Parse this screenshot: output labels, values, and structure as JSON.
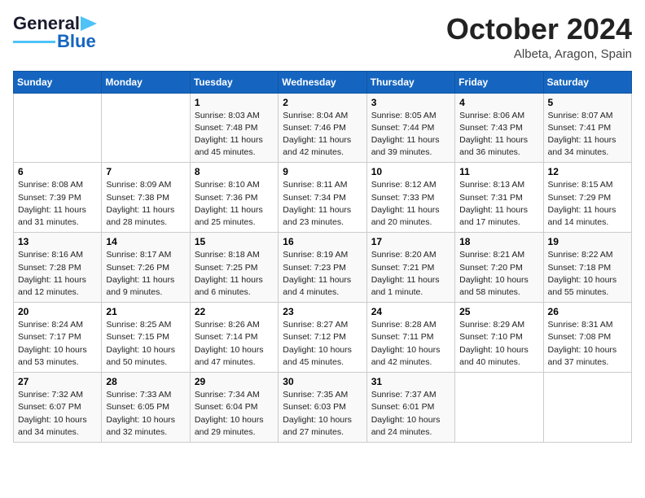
{
  "header": {
    "logo_general": "General",
    "logo_blue": "Blue",
    "month": "October 2024",
    "location": "Albeta, Aragon, Spain"
  },
  "days_of_week": [
    "Sunday",
    "Monday",
    "Tuesday",
    "Wednesday",
    "Thursday",
    "Friday",
    "Saturday"
  ],
  "weeks": [
    [
      {
        "day": "",
        "sunrise": "",
        "sunset": "",
        "daylight": ""
      },
      {
        "day": "",
        "sunrise": "",
        "sunset": "",
        "daylight": ""
      },
      {
        "day": "1",
        "sunrise": "Sunrise: 8:03 AM",
        "sunset": "Sunset: 7:48 PM",
        "daylight": "Daylight: 11 hours and 45 minutes."
      },
      {
        "day": "2",
        "sunrise": "Sunrise: 8:04 AM",
        "sunset": "Sunset: 7:46 PM",
        "daylight": "Daylight: 11 hours and 42 minutes."
      },
      {
        "day": "3",
        "sunrise": "Sunrise: 8:05 AM",
        "sunset": "Sunset: 7:44 PM",
        "daylight": "Daylight: 11 hours and 39 minutes."
      },
      {
        "day": "4",
        "sunrise": "Sunrise: 8:06 AM",
        "sunset": "Sunset: 7:43 PM",
        "daylight": "Daylight: 11 hours and 36 minutes."
      },
      {
        "day": "5",
        "sunrise": "Sunrise: 8:07 AM",
        "sunset": "Sunset: 7:41 PM",
        "daylight": "Daylight: 11 hours and 34 minutes."
      }
    ],
    [
      {
        "day": "6",
        "sunrise": "Sunrise: 8:08 AM",
        "sunset": "Sunset: 7:39 PM",
        "daylight": "Daylight: 11 hours and 31 minutes."
      },
      {
        "day": "7",
        "sunrise": "Sunrise: 8:09 AM",
        "sunset": "Sunset: 7:38 PM",
        "daylight": "Daylight: 11 hours and 28 minutes."
      },
      {
        "day": "8",
        "sunrise": "Sunrise: 8:10 AM",
        "sunset": "Sunset: 7:36 PM",
        "daylight": "Daylight: 11 hours and 25 minutes."
      },
      {
        "day": "9",
        "sunrise": "Sunrise: 8:11 AM",
        "sunset": "Sunset: 7:34 PM",
        "daylight": "Daylight: 11 hours and 23 minutes."
      },
      {
        "day": "10",
        "sunrise": "Sunrise: 8:12 AM",
        "sunset": "Sunset: 7:33 PM",
        "daylight": "Daylight: 11 hours and 20 minutes."
      },
      {
        "day": "11",
        "sunrise": "Sunrise: 8:13 AM",
        "sunset": "Sunset: 7:31 PM",
        "daylight": "Daylight: 11 hours and 17 minutes."
      },
      {
        "day": "12",
        "sunrise": "Sunrise: 8:15 AM",
        "sunset": "Sunset: 7:29 PM",
        "daylight": "Daylight: 11 hours and 14 minutes."
      }
    ],
    [
      {
        "day": "13",
        "sunrise": "Sunrise: 8:16 AM",
        "sunset": "Sunset: 7:28 PM",
        "daylight": "Daylight: 11 hours and 12 minutes."
      },
      {
        "day": "14",
        "sunrise": "Sunrise: 8:17 AM",
        "sunset": "Sunset: 7:26 PM",
        "daylight": "Daylight: 11 hours and 9 minutes."
      },
      {
        "day": "15",
        "sunrise": "Sunrise: 8:18 AM",
        "sunset": "Sunset: 7:25 PM",
        "daylight": "Daylight: 11 hours and 6 minutes."
      },
      {
        "day": "16",
        "sunrise": "Sunrise: 8:19 AM",
        "sunset": "Sunset: 7:23 PM",
        "daylight": "Daylight: 11 hours and 4 minutes."
      },
      {
        "day": "17",
        "sunrise": "Sunrise: 8:20 AM",
        "sunset": "Sunset: 7:21 PM",
        "daylight": "Daylight: 11 hours and 1 minute."
      },
      {
        "day": "18",
        "sunrise": "Sunrise: 8:21 AM",
        "sunset": "Sunset: 7:20 PM",
        "daylight": "Daylight: 10 hours and 58 minutes."
      },
      {
        "day": "19",
        "sunrise": "Sunrise: 8:22 AM",
        "sunset": "Sunset: 7:18 PM",
        "daylight": "Daylight: 10 hours and 55 minutes."
      }
    ],
    [
      {
        "day": "20",
        "sunrise": "Sunrise: 8:24 AM",
        "sunset": "Sunset: 7:17 PM",
        "daylight": "Daylight: 10 hours and 53 minutes."
      },
      {
        "day": "21",
        "sunrise": "Sunrise: 8:25 AM",
        "sunset": "Sunset: 7:15 PM",
        "daylight": "Daylight: 10 hours and 50 minutes."
      },
      {
        "day": "22",
        "sunrise": "Sunrise: 8:26 AM",
        "sunset": "Sunset: 7:14 PM",
        "daylight": "Daylight: 10 hours and 47 minutes."
      },
      {
        "day": "23",
        "sunrise": "Sunrise: 8:27 AM",
        "sunset": "Sunset: 7:12 PM",
        "daylight": "Daylight: 10 hours and 45 minutes."
      },
      {
        "day": "24",
        "sunrise": "Sunrise: 8:28 AM",
        "sunset": "Sunset: 7:11 PM",
        "daylight": "Daylight: 10 hours and 42 minutes."
      },
      {
        "day": "25",
        "sunrise": "Sunrise: 8:29 AM",
        "sunset": "Sunset: 7:10 PM",
        "daylight": "Daylight: 10 hours and 40 minutes."
      },
      {
        "day": "26",
        "sunrise": "Sunrise: 8:31 AM",
        "sunset": "Sunset: 7:08 PM",
        "daylight": "Daylight: 10 hours and 37 minutes."
      }
    ],
    [
      {
        "day": "27",
        "sunrise": "Sunrise: 7:32 AM",
        "sunset": "Sunset: 6:07 PM",
        "daylight": "Daylight: 10 hours and 34 minutes."
      },
      {
        "day": "28",
        "sunrise": "Sunrise: 7:33 AM",
        "sunset": "Sunset: 6:05 PM",
        "daylight": "Daylight: 10 hours and 32 minutes."
      },
      {
        "day": "29",
        "sunrise": "Sunrise: 7:34 AM",
        "sunset": "Sunset: 6:04 PM",
        "daylight": "Daylight: 10 hours and 29 minutes."
      },
      {
        "day": "30",
        "sunrise": "Sunrise: 7:35 AM",
        "sunset": "Sunset: 6:03 PM",
        "daylight": "Daylight: 10 hours and 27 minutes."
      },
      {
        "day": "31",
        "sunrise": "Sunrise: 7:37 AM",
        "sunset": "Sunset: 6:01 PM",
        "daylight": "Daylight: 10 hours and 24 minutes."
      },
      {
        "day": "",
        "sunrise": "",
        "sunset": "",
        "daylight": ""
      },
      {
        "day": "",
        "sunrise": "",
        "sunset": "",
        "daylight": ""
      }
    ]
  ]
}
